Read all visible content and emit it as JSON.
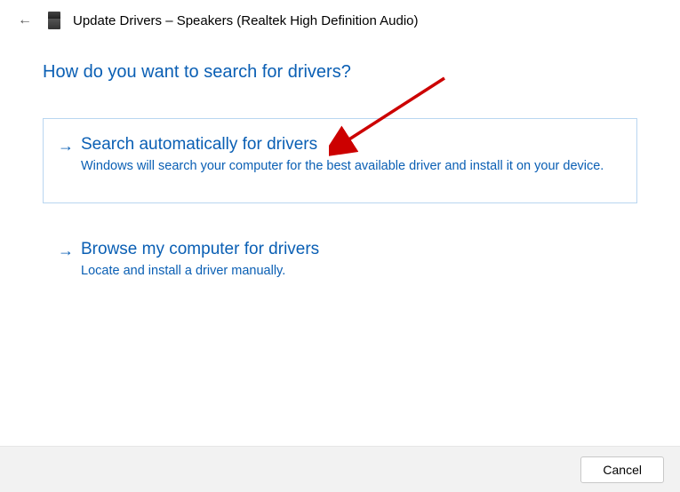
{
  "titlebar": {
    "title": "Update Drivers – Speakers (Realtek High Definition Audio)"
  },
  "heading": "How do you want to search for drivers?",
  "options": [
    {
      "title": "Search automatically for drivers",
      "desc": "Windows will search your computer for the best available driver and install it on your device."
    },
    {
      "title": "Browse my computer for drivers",
      "desc": "Locate and install a driver manually."
    }
  ],
  "footer": {
    "cancel": "Cancel"
  },
  "colors": {
    "accent": "#0a5fb4",
    "annotation": "#cc0000"
  }
}
